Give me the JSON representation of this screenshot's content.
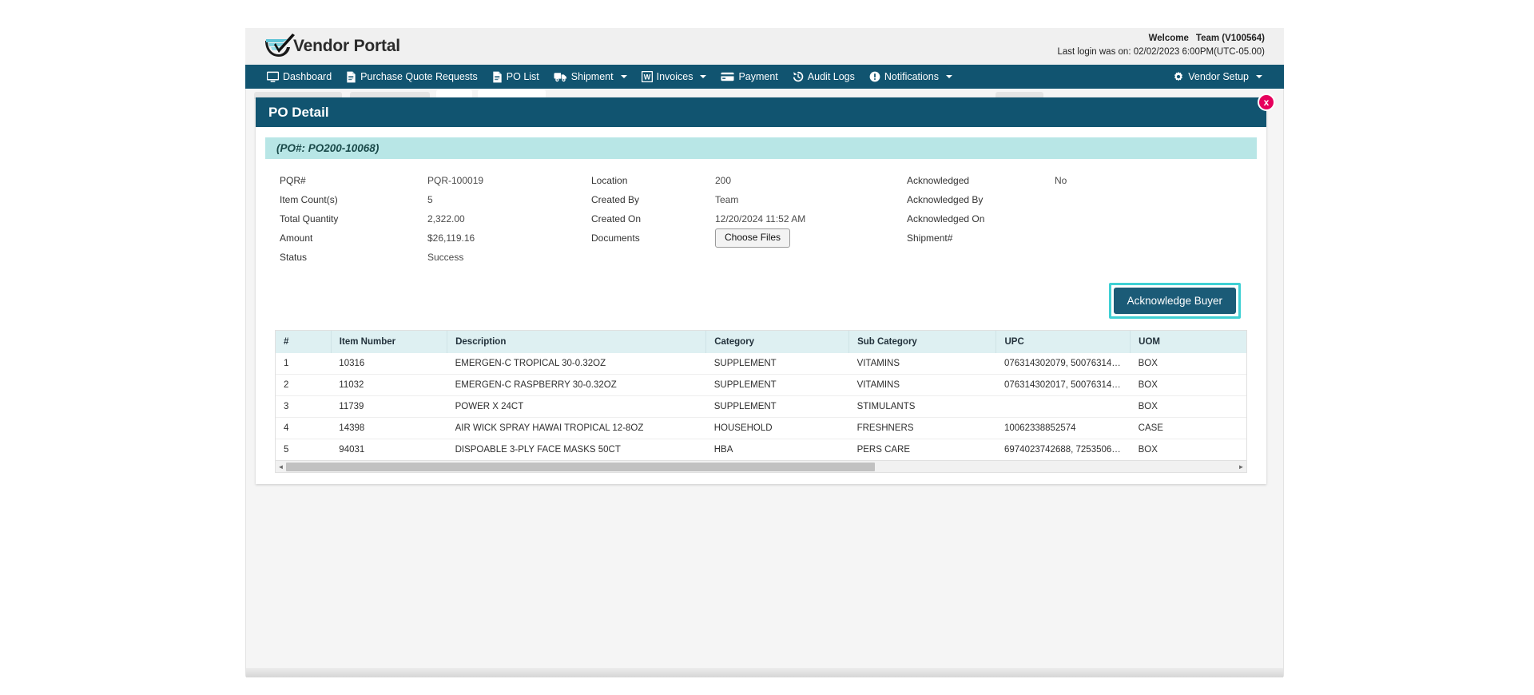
{
  "brand": {
    "logo_icon": "checkmark-swoosh-logo",
    "name": "Vendor Portal"
  },
  "welcome": {
    "greeting": "Welcome",
    "user": "Team (V100564)",
    "last_login": "Last login was on: 02/02/2023 6:00PM(UTC-05.00)"
  },
  "nav": {
    "items": [
      {
        "label": "Dashboard",
        "icon": "monitor-icon",
        "caret": false
      },
      {
        "label": "Purchase Quote Requests",
        "icon": "document-icon",
        "caret": false
      },
      {
        "label": "PO List",
        "icon": "document-icon",
        "caret": false
      },
      {
        "label": "Shipment",
        "icon": "truck-icon",
        "caret": true
      },
      {
        "label": "Invoices",
        "icon": "word-doc-icon",
        "caret": true
      },
      {
        "label": "Payment",
        "icon": "credit-card-icon",
        "caret": false
      },
      {
        "label": "Audit Logs",
        "icon": "history-icon",
        "caret": false
      },
      {
        "label": "Notifications",
        "icon": "alert-circle-icon",
        "caret": true
      }
    ],
    "right": {
      "label": "Vendor Setup",
      "icon": "gear-icon",
      "caret": true
    }
  },
  "card": {
    "title": "PO Detail",
    "close_label": "x",
    "po_banner": "(PO#: PO200-10068)"
  },
  "details": {
    "pqr_label": "PQR#",
    "pqr_value": "PQR-100019",
    "item_count_label": "Item Count(s)",
    "item_count_value": "5",
    "total_qty_label": "Total Quantity",
    "total_qty_value": "2,322.00",
    "amount_label": "Amount",
    "amount_value": "$26,119.16",
    "status_label": "Status",
    "status_value": "Success",
    "location_label": "Location",
    "location_value": "200",
    "created_by_label": "Created By",
    "created_by_value": "Team",
    "created_on_label": "Created On",
    "created_on_value": "12/20/2024 11:52 AM",
    "documents_label": "Documents",
    "choose_files_label": "Choose Files",
    "acknowledged_label": "Acknowledged",
    "acknowledged_value": "No",
    "acknowledged_by_label": "Acknowledged By",
    "acknowledged_by_value": "",
    "acknowledged_on_label": "Acknowledged On",
    "acknowledged_on_value": "",
    "shipment_label": "Shipment#",
    "shipment_value": ""
  },
  "actions": {
    "acknowledge_buyer_label": "Acknowledge Buyer"
  },
  "table": {
    "columns": [
      "#",
      "Item Number",
      "Description",
      "Category",
      "Sub Category",
      "UPC",
      "UOM"
    ],
    "rows": [
      {
        "num": "1",
        "item_number": "10316",
        "description": "EMERGEN-C TROPICAL 30-0.32OZ",
        "category": "SUPPLEMENT",
        "sub_category": "VITAMINS",
        "upc": "076314302079, 500763143...",
        "uom": "BOX"
      },
      {
        "num": "2",
        "item_number": "11032",
        "description": "EMERGEN-C RASPBERRY 30-0.32OZ",
        "category": "SUPPLEMENT",
        "sub_category": "VITAMINS",
        "upc": "076314302017, 500763143...",
        "uom": "BOX"
      },
      {
        "num": "3",
        "item_number": "11739",
        "description": "POWER X 24CT",
        "category": "SUPPLEMENT",
        "sub_category": "STIMULANTS",
        "upc": "",
        "uom": "BOX"
      },
      {
        "num": "4",
        "item_number": "14398",
        "description": "AIR WICK SPRAY HAWAI TROPICAL 12-8OZ",
        "category": "HOUSEHOLD",
        "sub_category": "FRESHNERS",
        "upc": "10062338852574",
        "uom": "CASE"
      },
      {
        "num": "5",
        "item_number": "94031",
        "description": "DISPOABLE 3-PLY FACE MASKS 50CT",
        "category": "HBA",
        "sub_category": "PERS CARE",
        "upc": "6974023742688, 72535060...",
        "uom": "BOX"
      }
    ]
  },
  "scrollbar": {
    "left_arrow": "◄",
    "right_arrow": "►"
  },
  "colors": {
    "nav_blue": "#115470",
    "banner_teal": "#b8e6e6",
    "table_header": "#def0f2",
    "highlight": "#3fd0d4",
    "close_pink": "#e6005c"
  }
}
